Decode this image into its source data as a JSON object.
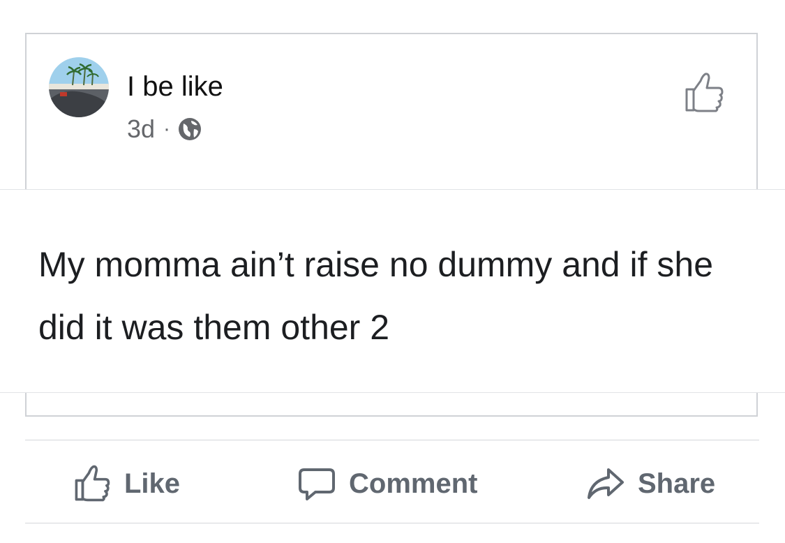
{
  "post": {
    "author": "I be like",
    "time": "3d",
    "separator": "·",
    "privacy_icon": "globe-icon",
    "text": "My momma ain’t raise no dummy and if she did it was them other 2",
    "corner_icon": "thumbs-up-icon"
  },
  "actions": {
    "like_label": "Like",
    "comment_label": "Comment",
    "share_label": "Share"
  },
  "colors": {
    "text_primary": "#1c1e21",
    "text_secondary": "#65676b",
    "action_text": "#606770",
    "border": "#cfd2d6"
  }
}
